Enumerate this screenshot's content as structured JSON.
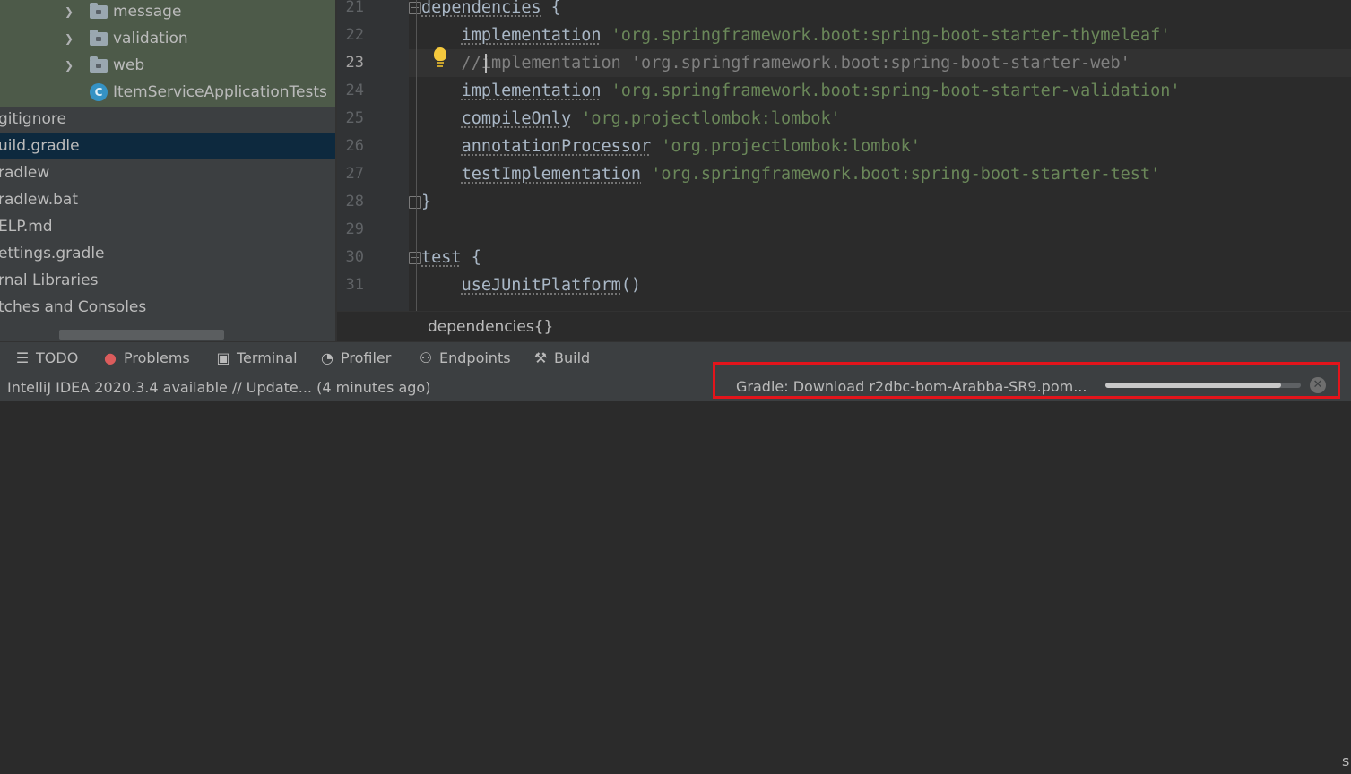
{
  "project_tree": {
    "items": [
      {
        "label": "message",
        "type": "folder",
        "icon": "folder-icon",
        "expandable": true,
        "selected": false
      },
      {
        "label": "validation",
        "type": "folder",
        "icon": "folder-icon",
        "expandable": true,
        "selected": false
      },
      {
        "label": "web",
        "type": "folder",
        "icon": "folder-icon",
        "expandable": true,
        "selected": false
      },
      {
        "label": "ItemServiceApplicationTests",
        "type": "class",
        "icon": "class-icon",
        "icon_letter": "C",
        "expandable": false,
        "selected": false
      },
      {
        "label": "gitignore",
        "type": "file",
        "selected": false
      },
      {
        "label": "uild.gradle",
        "type": "file",
        "selected": true
      },
      {
        "label": "radlew",
        "type": "file",
        "selected": false
      },
      {
        "label": "radlew.bat",
        "type": "file",
        "selected": false
      },
      {
        "label": "ELP.md",
        "type": "file",
        "selected": false
      },
      {
        "label": "ettings.gradle",
        "type": "file",
        "selected": false
      },
      {
        "label": "rnal Libraries",
        "type": "group",
        "selected": false
      },
      {
        "label": "tches and Consoles",
        "type": "group",
        "selected": false
      }
    ]
  },
  "editor": {
    "current_line": 23,
    "lines": [
      {
        "num": "21",
        "tokens": [
          {
            "t": "dependencies",
            "c": "kw"
          },
          {
            "t": " {",
            "c": "plain"
          }
        ],
        "fold": true
      },
      {
        "num": "22",
        "tokens": [
          {
            "t": "    ",
            "c": "plain"
          },
          {
            "t": "implementation",
            "c": "kw"
          },
          {
            "t": " ",
            "c": "plain"
          },
          {
            "t": "'org.springframework.boot:spring-boot-starter-thymeleaf'",
            "c": "str"
          }
        ]
      },
      {
        "num": "23",
        "tokens": [
          {
            "t": "    //implementation 'org.springframework.boot:spring-boot-starter-web'",
            "c": "cmt"
          }
        ]
      },
      {
        "num": "24",
        "tokens": [
          {
            "t": "    ",
            "c": "plain"
          },
          {
            "t": "implementation",
            "c": "kw"
          },
          {
            "t": " ",
            "c": "plain"
          },
          {
            "t": "'org.springframework.boot:spring-boot-starter-validation'",
            "c": "str"
          }
        ]
      },
      {
        "num": "25",
        "tokens": [
          {
            "t": "    ",
            "c": "plain"
          },
          {
            "t": "compileOnly",
            "c": "kw"
          },
          {
            "t": " ",
            "c": "plain"
          },
          {
            "t": "'org.projectlombok:lombok'",
            "c": "str"
          }
        ]
      },
      {
        "num": "26",
        "tokens": [
          {
            "t": "    ",
            "c": "plain"
          },
          {
            "t": "annotationProcessor",
            "c": "kw"
          },
          {
            "t": " ",
            "c": "plain"
          },
          {
            "t": "'org.projectlombok:lombok'",
            "c": "str"
          }
        ]
      },
      {
        "num": "27",
        "tokens": [
          {
            "t": "    ",
            "c": "plain"
          },
          {
            "t": "testImplementation",
            "c": "kw"
          },
          {
            "t": " ",
            "c": "plain"
          },
          {
            "t": "'org.springframework.boot:spring-boot-starter-test'",
            "c": "str"
          }
        ]
      },
      {
        "num": "28",
        "tokens": [
          {
            "t": "}",
            "c": "plain"
          }
        ],
        "fold": true
      },
      {
        "num": "29",
        "tokens": []
      },
      {
        "num": "30",
        "tokens": [
          {
            "t": "test",
            "c": "kw"
          },
          {
            "t": " {",
            "c": "plain"
          }
        ],
        "fold": true
      },
      {
        "num": "31",
        "tokens": [
          {
            "t": "    ",
            "c": "plain"
          },
          {
            "t": "useJUnitPlatform",
            "c": "kw"
          },
          {
            "t": "()",
            "c": "plain"
          }
        ]
      }
    ],
    "breadcrumb": "dependencies{}",
    "intention_icon": "lightbulb-icon"
  },
  "tool_windows": [
    {
      "label": "TODO",
      "icon": "todo-list-icon",
      "glyph": "☰",
      "color": "#bbbbbb"
    },
    {
      "label": "Problems",
      "icon": "problems-error-icon",
      "glyph": "●",
      "color": "#db5c5c"
    },
    {
      "label": "Terminal",
      "icon": "terminal-icon",
      "glyph": "▣",
      "color": "#bbbbbb"
    },
    {
      "label": "Profiler",
      "icon": "profiler-icon",
      "glyph": "◔",
      "color": "#bbbbbb"
    },
    {
      "label": "Endpoints",
      "icon": "endpoints-icon",
      "glyph": "⚇",
      "color": "#bbbbbb"
    },
    {
      "label": "Build",
      "icon": "build-hammer-icon",
      "glyph": "⚒",
      "color": "#bbbbbb"
    }
  ],
  "status_bar": {
    "message": "IntelliJ IDEA 2020.3.4 available // Update... (4 minutes ago)",
    "background_task": "Gradle: Download r2dbc-bom-Arabba-SR9.pom...",
    "progress_fraction": 0.9,
    "cancel_icon": "cancel-circle-icon",
    "edge_text": "s"
  },
  "colors": {
    "highlight_box": "#e3141b",
    "selection": "#0d293e",
    "string": "#6a8759",
    "comment": "#808080",
    "progress_fill": "#c9c9c9"
  }
}
